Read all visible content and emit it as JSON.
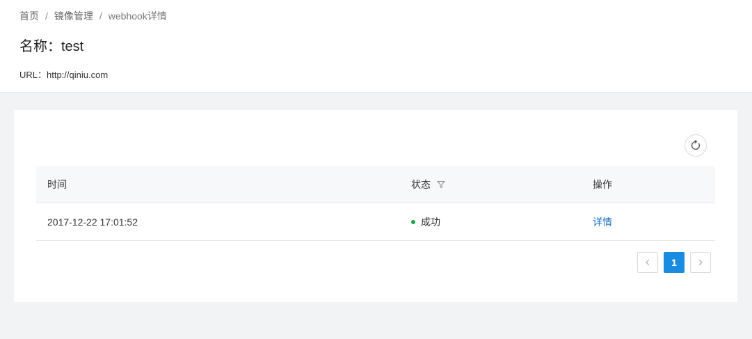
{
  "breadcrumb": {
    "items": [
      "首页",
      "镜像管理"
    ],
    "current": "webhook详情",
    "separator": "/"
  },
  "title": {
    "label": "名称：",
    "value": "test"
  },
  "url": {
    "label": "URL：",
    "value": "http://qiniu.com"
  },
  "table": {
    "columns": [
      "时间",
      "状态",
      "操作"
    ],
    "rows": [
      {
        "time": "2017-12-22 17:01:52",
        "status": "成功",
        "status_color": "#1aa34a",
        "action": "详情"
      }
    ]
  },
  "pagination": {
    "prev_icon": "chevron-left-icon",
    "next_icon": "chevron-right-icon",
    "current_page": "1",
    "active_color": "#1a8cdf"
  },
  "icons": {
    "refresh": "refresh-icon",
    "filter": "filter-icon"
  }
}
